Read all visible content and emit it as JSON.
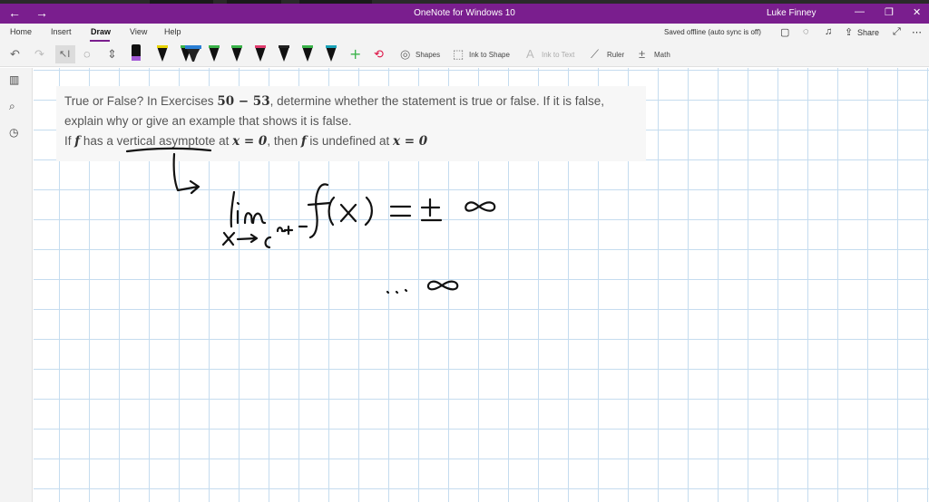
{
  "titlebar": {
    "title": "OneNote for Windows 10",
    "user": "Luke Finney",
    "back_icon": "arrow-left-icon",
    "forward_icon": "arrow-right-icon"
  },
  "menu": {
    "tabs": [
      "Home",
      "Insert",
      "Draw",
      "View",
      "Help"
    ],
    "active_tab": "Draw",
    "saved_status": "Saved offline (auto sync is off)",
    "share_label": "Share"
  },
  "toolbar": {
    "shapes_label": "Shapes",
    "ink_to_shape_label": "Ink to Shape",
    "ink_to_text_label": "Ink to Text",
    "ruler_label": "Ruler",
    "math_label": "Math",
    "pen_colors": [
      "#1a1a1a",
      "#e6d200",
      "#3bb34a",
      "#2a7fd4",
      "#3bb34a",
      "#c0178c",
      "#222222",
      "#e03c6e",
      "#222222",
      "#3bb34a",
      "#1aa3b8"
    ]
  },
  "problem": {
    "line1_a": "True or False? In Exercises ",
    "line1_math": "50 − 53",
    "line1_b": ", determine whether the statement is true or false. If it is false,",
    "line2": "explain why or give an example that shows it is false.",
    "line3_a": "If ",
    "line3_f1": "f",
    "line3_b": " has a vertical asymptote at ",
    "line3_x1": "x = 0",
    "line3_c": ", then ",
    "line3_f2": "f",
    "line3_d": " is undefined at ",
    "line3_x2": "x = 0"
  },
  "colors": {
    "accent": "#7a1e8e",
    "grid": "#c5dcef"
  }
}
